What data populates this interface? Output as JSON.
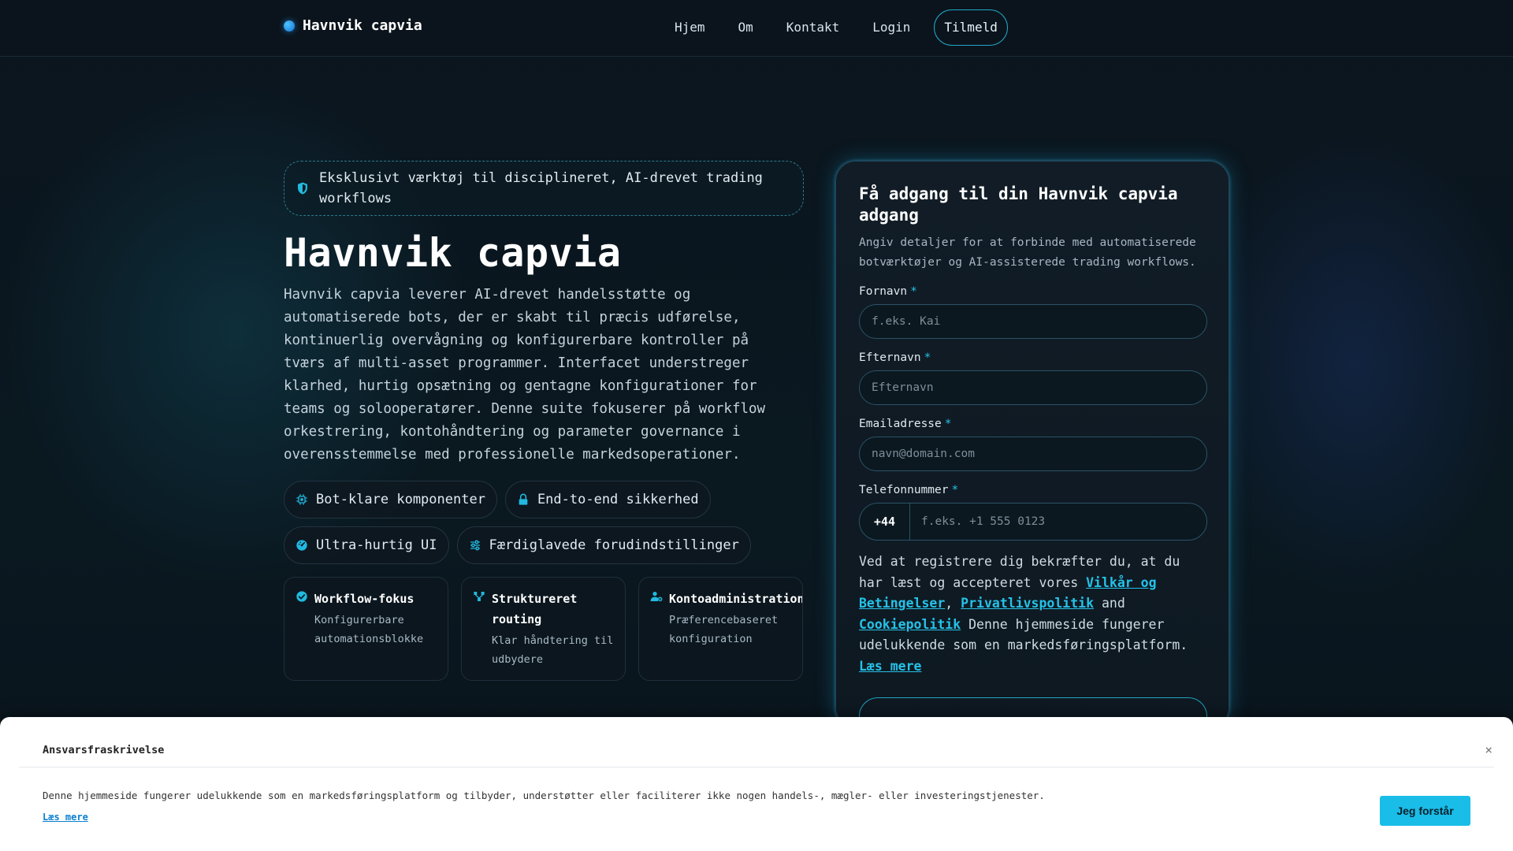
{
  "nav": {
    "brand": "Havnvik capvia",
    "links": [
      "Hjem",
      "Om",
      "Kontakt",
      "Login"
    ],
    "cta": "Tilmeld"
  },
  "hero": {
    "tagline": "Eksklusivt værktøj til disciplineret, AI-drevet trading workflows",
    "title": "Havnvik capvia",
    "description": "Havnvik capvia leverer AI-drevet handelsstøtte og automatiserede bots, der er skabt til præcis udførelse, kontinuerlig overvågning og konfigurerbare kontroller på tværs af multi-asset programmer. Interfacet understreger klarhed, hurtig opsætning og gentagne konfigurationer for teams og solooperatører. Denne suite fokuserer på workflow orkestrering, kontohåndtering og parameter governance i overensstemmelse med professionelle markedsoperationer.",
    "chips": [
      {
        "label": "Bot-klare komponenter",
        "icon": "chip-icon"
      },
      {
        "label": "End-to-end sikkerhed",
        "icon": "lock-icon"
      },
      {
        "label": "Ultra-hurtig UI",
        "icon": "gauge-icon"
      },
      {
        "label": "Færdiglavede forudindstillinger",
        "icon": "sliders-icon"
      }
    ],
    "features": [
      {
        "title": "Workflow-fokus",
        "body": "Konfigurerbare automationsblokke",
        "icon": "check-circle-icon"
      },
      {
        "title": "Struktureret routing",
        "body": "Klar håndtering til udbydere",
        "icon": "routing-icon"
      },
      {
        "title": "Kontoadministration",
        "body": "Præferencebaseret konfiguration",
        "icon": "user-gear-icon"
      }
    ]
  },
  "form": {
    "title": "Få adgang til din Havnvik capvia adgang",
    "subtitle": "Angiv detaljer for at forbinde med automatiserede botværktøjer og AI-assisterede trading workflows.",
    "first_name": {
      "label": "Fornavn",
      "required": "*",
      "placeholder": "f.eks. Kai"
    },
    "last_name": {
      "label": "Efternavn",
      "required": "*",
      "placeholder": "Efternavn"
    },
    "email": {
      "label": "Emailadresse",
      "required": "*",
      "placeholder": "navn@domain.com"
    },
    "phone": {
      "label": "Telefonnummer",
      "required": "*",
      "code": "+44",
      "placeholder": "f.eks. +1 555 0123"
    },
    "consent": {
      "part1": "Ved at registrere dig bekræfter du, at du har læst og accepteret vores ",
      "terms": "Vilkår og Betingelser",
      "sep1": ", ",
      "privacy": "Privatlivspolitik",
      "sep2": " and ",
      "cookies": "Cookiepolitik",
      "part2": " Denne hjemmeside fungerer udelukkende som en markedsføringsplatform. ",
      "read_more": "Læs mere"
    }
  },
  "banner": {
    "title": "Ansvarsfraskrivelse",
    "close": "×",
    "body": "Denne hjemmeside fungerer udelukkende som en markedsføringsplatform og tilbyder, understøtter eller faciliterer ikke nogen handels-, mægler- eller investeringstjenester.",
    "read_more": "Læs mere",
    "button": "Jeg forstår"
  },
  "colors": {
    "accent": "#25c2e8",
    "background": "#0a141d",
    "banner_button": "#19bde8"
  }
}
